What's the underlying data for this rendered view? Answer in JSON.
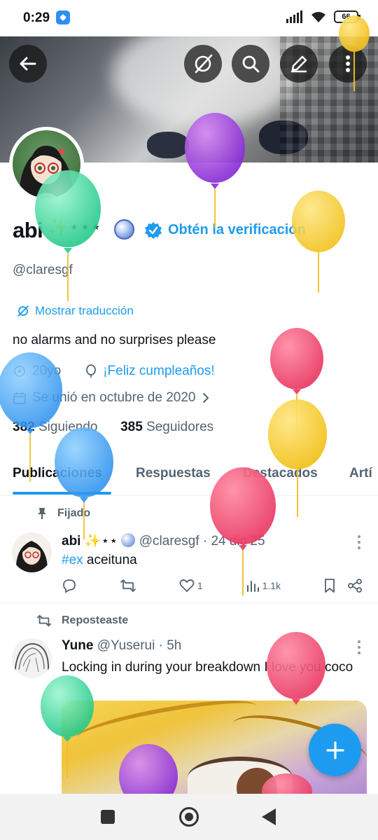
{
  "status_bar": {
    "time": "0:29",
    "battery": "66"
  },
  "profile": {
    "display_name": "abi",
    "name_emoji": "✨⋆⋆⋆",
    "verification_cta": "Obtén la verificación",
    "handle": "@claresgf",
    "translate": "Mostrar traducción",
    "bio": "no alarms and no surprises please",
    "age": "20yo",
    "birthday": "¡Feliz cumpleaños!",
    "joined": "Se unió en octubre de 2020",
    "following_count": "382",
    "following_label": "Siguiendo",
    "followers_count": "385",
    "followers_label": "Seguidores"
  },
  "tabs": [
    "Publicaciones",
    "Respuestas",
    "Destacados",
    "Artí"
  ],
  "pinned_post": {
    "label": "Fijado",
    "author": "abi",
    "author_emoji": "✨⋆⋆",
    "handle_time": "@claresgf · 24 dic 25",
    "hashtag": "#ex",
    "text": " aceituna",
    "likes": "1",
    "views": "1.1k"
  },
  "repost": {
    "label": "Reposteaste",
    "author": "Yune",
    "handle_time": "@Yuserui · 5h",
    "text": "Locking in during your breakdown I love you coco"
  },
  "icons": {
    "header": [
      "back-arrow-icon",
      "no-translate-icon",
      "search-icon",
      "edit-icon",
      "more-vertical-icon"
    ],
    "actions": [
      "reply-icon",
      "repost-icon",
      "like-icon",
      "views-icon",
      "bookmark-icon",
      "share-icon"
    ]
  },
  "colors": {
    "accent": "#1d9bf0",
    "text": "#0f1419",
    "secondary": "#536471"
  }
}
